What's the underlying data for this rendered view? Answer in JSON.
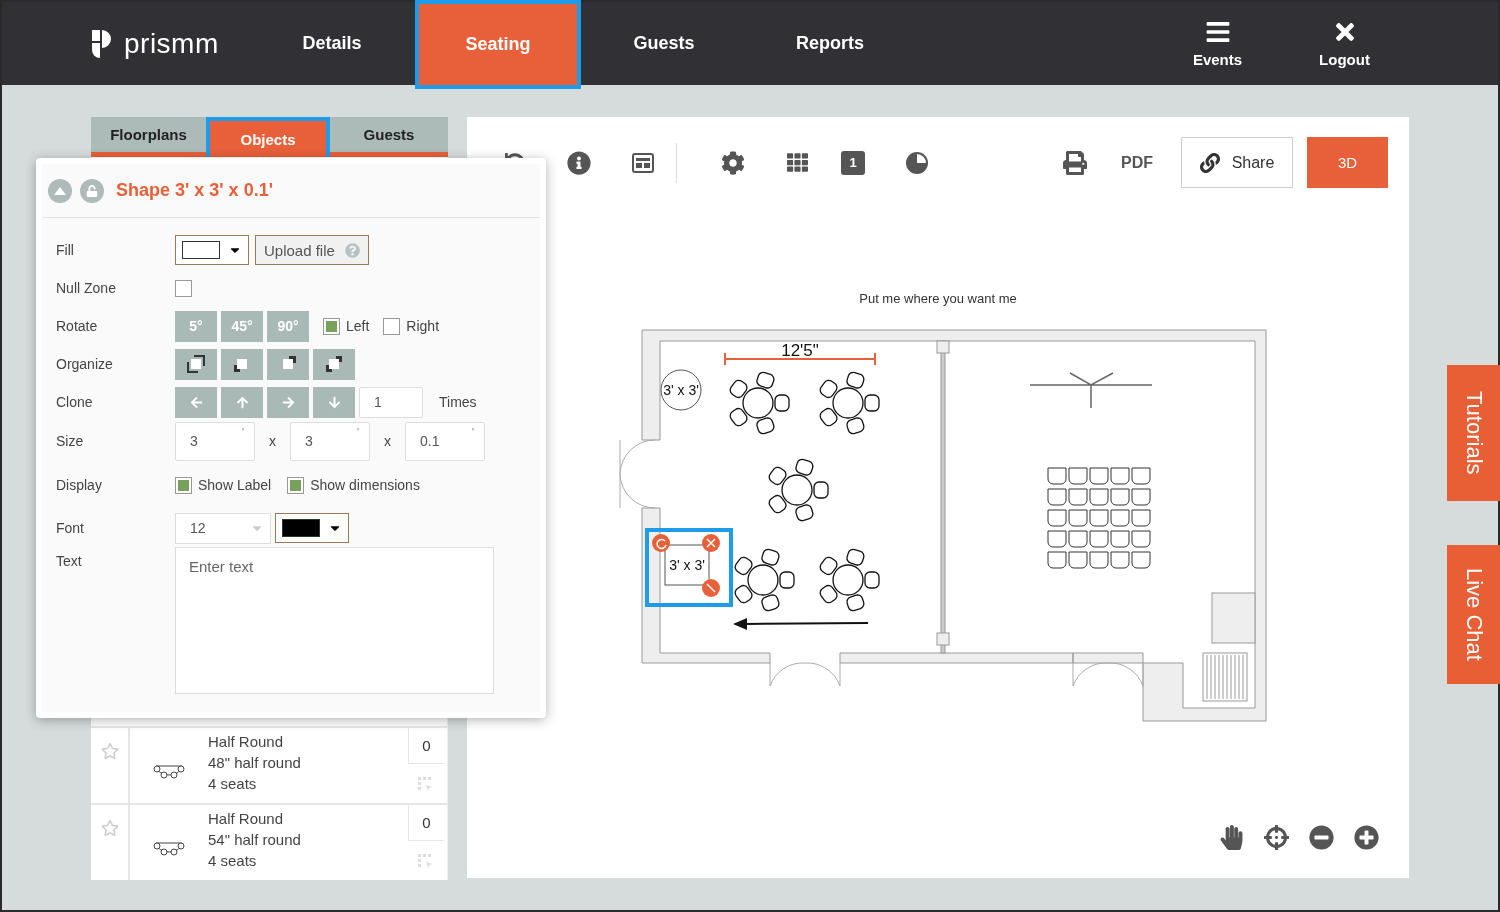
{
  "nav": {
    "logo": "prismm",
    "tabs": [
      {
        "label": "Details",
        "selected": false
      },
      {
        "label": "Seating",
        "selected": true
      },
      {
        "label": "Guests",
        "selected": false
      },
      {
        "label": "Reports",
        "selected": false
      }
    ],
    "actions": [
      {
        "kind": "menu",
        "label": "Events"
      },
      {
        "kind": "close",
        "label": "Logout"
      }
    ]
  },
  "side_tabs": [
    {
      "label": "Floorplans",
      "selected": false
    },
    {
      "label": "Objects",
      "selected": true
    },
    {
      "label": "Guests",
      "selected": false
    }
  ],
  "objects": [
    {
      "name": "Half Round",
      "description": "48\" half round",
      "seats": "4 seats",
      "count": "0",
      "favorite": false
    },
    {
      "name": "Half Round",
      "description": "54\" half round",
      "seats": "4 seats",
      "count": "0",
      "favorite": false
    }
  ],
  "object_panel": {
    "title": "Shape 3' x 3' x 0.1'",
    "locked": false,
    "fields": [
      {
        "kind": "fill",
        "label": "Fill",
        "upload": "Upload file"
      },
      {
        "kind": "checkbox",
        "label": "Null Zone",
        "checked": false
      },
      {
        "kind": "rotate",
        "label": "Rotate",
        "steps": [
          "5°",
          "45°",
          "90°"
        ],
        "directions": [
          {
            "label": "Left",
            "checked": true
          },
          {
            "label": "Right",
            "checked": false
          }
        ]
      },
      {
        "kind": "organize",
        "label": "Organize"
      },
      {
        "kind": "clone",
        "label": "Clone",
        "value": "1",
        "unit": "Times"
      },
      {
        "kind": "size",
        "label": "Size",
        "values": [
          {
            "value": "3",
            "unit": "'"
          },
          {
            "value": "3",
            "unit": "'"
          },
          {
            "value": "0.1",
            "unit": "'"
          }
        ],
        "separators": [
          "x",
          "x"
        ]
      },
      {
        "kind": "display",
        "label": "Display",
        "options": [
          {
            "label": "Show Label",
            "checked": true
          },
          {
            "label": "Show dimensions",
            "checked": true
          }
        ]
      },
      {
        "kind": "font",
        "label": "Font",
        "size": "12"
      },
      {
        "kind": "text",
        "label": "Text",
        "placeholder": "Enter text"
      }
    ]
  },
  "toolbar": {
    "page": "1",
    "pdf": "PDF",
    "share": "Share",
    "view_3d": "3D"
  },
  "canvas": {
    "hint": "Put me where you want me",
    "dimension": "12'5\"",
    "shapes": [
      {
        "kind": "circle",
        "label": "3' x 3'",
        "selected": false
      },
      {
        "kind": "square",
        "label": "3' x 3'",
        "selected": true
      }
    ]
  },
  "help_tabs": [
    "Tutorials",
    "Live Chat"
  ]
}
